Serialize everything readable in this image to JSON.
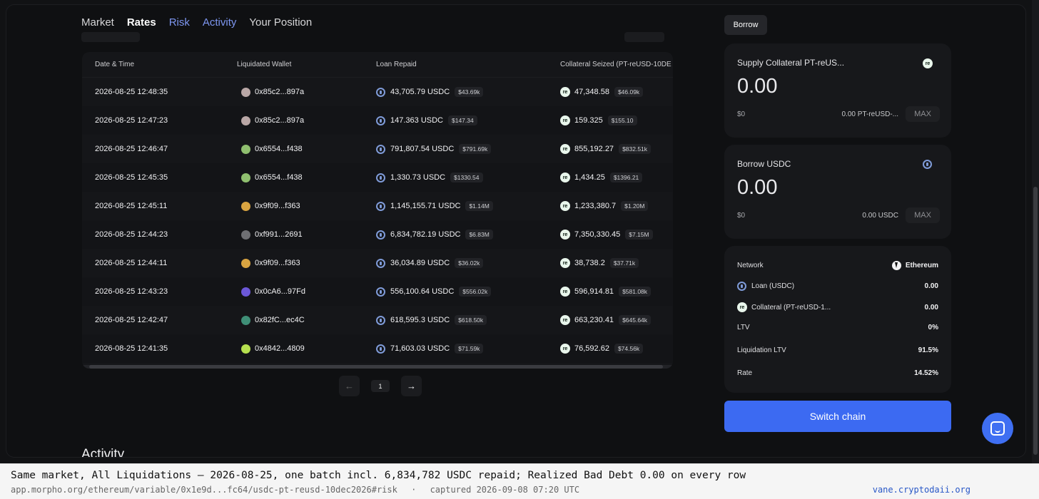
{
  "tabs": [
    "Market",
    "Rates",
    "Risk",
    "Activity",
    "Your Position"
  ],
  "table": {
    "headers": [
      "Date & Time",
      "Liquidated Wallet",
      "Loan Repaid",
      "Collateral Seized (PT-reUSD-10DE"
    ],
    "rows": [
      {
        "date": "2026-08-25 12:48:35",
        "wallet": "0x85c2...897a",
        "loan": "43,705.79 USDC",
        "loan_usd": "$43.69k",
        "collateral": "47,348.58",
        "collateral_usd": "$46.09k",
        "avatar_color": "#b9a7a6"
      },
      {
        "date": "2026-08-25 12:47:23",
        "wallet": "0x85c2...897a",
        "loan": "147.363 USDC",
        "loan_usd": "$147.34",
        "collateral": "159.325",
        "collateral_usd": "$155.10",
        "avatar_color": "#b9a7a6"
      },
      {
        "date": "2026-08-25 12:46:47",
        "wallet": "0x6554...f438",
        "loan": "791,807.54 USDC",
        "loan_usd": "$791.69k",
        "collateral": "855,192.27",
        "collateral_usd": "$832.51k",
        "avatar_color": "#8fbf6f"
      },
      {
        "date": "2026-08-25 12:45:35",
        "wallet": "0x6554...f438",
        "loan": "1,330.73 USDC",
        "loan_usd": "$1330.54",
        "collateral": "1,434.25",
        "collateral_usd": "$1396.21",
        "avatar_color": "#8fbf6f"
      },
      {
        "date": "2026-08-25 12:45:11",
        "wallet": "0x9f09...f363",
        "loan": "1,145,155.71 USDC",
        "loan_usd": "$1.14M",
        "collateral": "1,233,380.7",
        "collateral_usd": "$1.20M",
        "avatar_color": "#d9a441"
      },
      {
        "date": "2026-08-25 12:44:23",
        "wallet": "0xf991...2691",
        "loan": "6,834,782.19 USDC",
        "loan_usd": "$6.83M",
        "collateral": "7,350,330.45",
        "collateral_usd": "$7.15M",
        "avatar_color": "#6e6f73"
      },
      {
        "date": "2026-08-25 12:44:11",
        "wallet": "0x9f09...f363",
        "loan": "36,034.89 USDC",
        "loan_usd": "$36.02k",
        "collateral": "38,738.2",
        "collateral_usd": "$37.71k",
        "avatar_color": "#d9a441"
      },
      {
        "date": "2026-08-25 12:43:23",
        "wallet": "0x0cA6...97Fd",
        "loan": "556,100.64 USDC",
        "loan_usd": "$556.02k",
        "collateral": "596,914.81",
        "collateral_usd": "$581.08k",
        "avatar_color": "#6c58d8"
      },
      {
        "date": "2026-08-25 12:42:47",
        "wallet": "0x82fC...ec4C",
        "loan": "618,595.3 USDC",
        "loan_usd": "$618.50k",
        "collateral": "663,230.41",
        "collateral_usd": "$645.64k",
        "avatar_color": "#3f8f77"
      },
      {
        "date": "2026-08-25 12:41:35",
        "wallet": "0x4842...4809",
        "loan": "71,603.03 USDC",
        "loan_usd": "$71.59k",
        "collateral": "76,592.62",
        "collateral_usd": "$74.56k",
        "avatar_color": "#b6e04f"
      }
    ]
  },
  "pagination": {
    "page": "1",
    "prev_icon": "←",
    "next_icon": "→"
  },
  "section_heading": "Activity",
  "right_panel": {
    "borrow_tab": "Borrow",
    "supply": {
      "title": "Supply Collateral PT-reUS...",
      "value": "0.00",
      "usd": "$0",
      "balance": "0.00 PT-reUSD-...",
      "max": "MAX"
    },
    "borrow": {
      "title": "Borrow USDC",
      "value": "0.00",
      "usd": "$0",
      "balance": "0.00 USDC",
      "max": "MAX"
    },
    "info": {
      "network_label": "Network",
      "network_value": "Ethereum",
      "loan_label": "Loan (USDC)",
      "loan_value": "0.00",
      "collateral_label": "Collateral (PT-reUSD-1...",
      "collateral_value": "0.00",
      "ltv_label": "LTV",
      "ltv_value": "0%",
      "liq_label": "Liquidation LTV",
      "liq_value": "91.5%",
      "rate_label": "Rate",
      "rate_value": "14.52%"
    },
    "switch_chain": "Switch chain"
  },
  "caption": {
    "line1": "Same market, All Liquidations — 2026-08-25, one batch incl. 6,834,782 USDC repaid; Realized Bad Debt 0.00 on every row",
    "url": "app.morpho.org/ethereum/variable/0x1e9d...fc64/usdc-pt-reusd-10dec2026#risk",
    "separator": "·",
    "captured": "captured 2026-09-08 07:20 UTC",
    "site": "vane.cryptodaii.org"
  },
  "colors": {
    "accent": "#3c6af2",
    "chat": "#3f6ff2",
    "tab_blue": "#7d96f0"
  },
  "icons": {
    "usdc": "usdc-icon",
    "re": "re-token-icon",
    "eth": "ethereum-icon",
    "chat": "chat-icon"
  }
}
